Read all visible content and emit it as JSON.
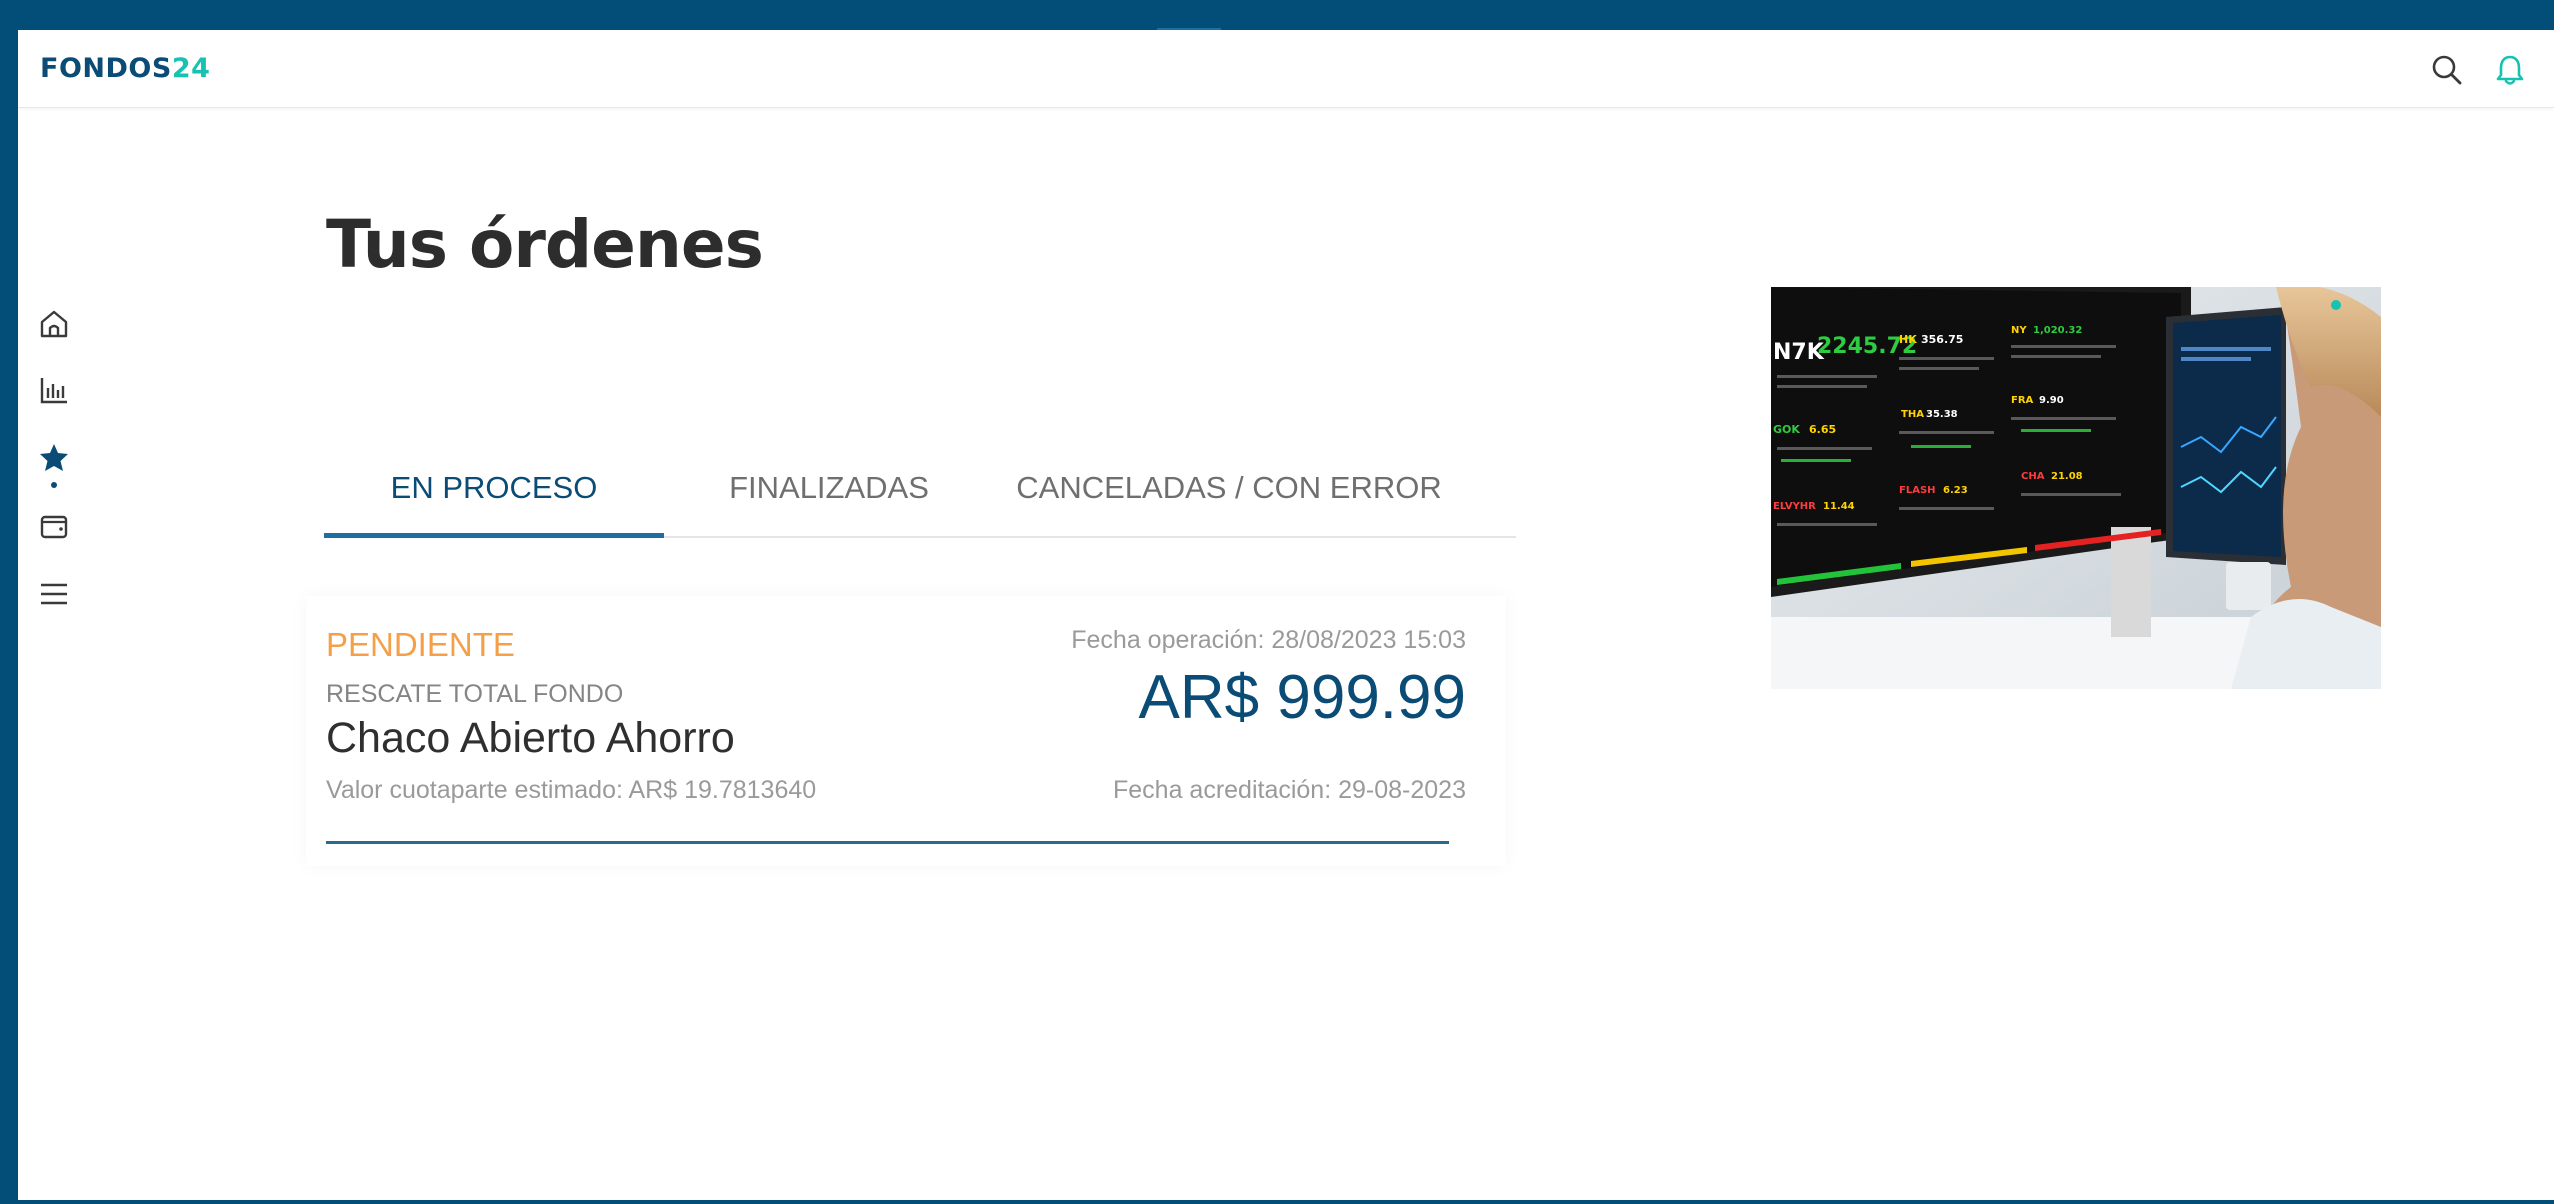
{
  "header": {
    "logo_primary": "FONDOS",
    "logo_accent": "24",
    "icons": [
      "search-icon",
      "bell-icon"
    ]
  },
  "sidebar": {
    "items": [
      {
        "icon": "home-icon"
      },
      {
        "icon": "bar-chart-icon"
      },
      {
        "icon": "star-icon",
        "active": true
      },
      {
        "icon": "wallet-icon"
      },
      {
        "icon": "menu-icon"
      }
    ]
  },
  "page": {
    "title": "Tus órdenes"
  },
  "tabs": [
    {
      "label": "EN PROCESO",
      "active": true
    },
    {
      "label": "FINALIZADAS",
      "active": false
    },
    {
      "label": "CANCELADAS / CON ERROR",
      "active": false
    }
  ],
  "order": {
    "status": "PENDIENTE",
    "operation_type": "RESCATE TOTAL FONDO",
    "fund_name": "Chaco Abierto Ahorro",
    "unit_value": "Valor cuotaparte estimado: AR$ 19.7813640",
    "operation_date": "Fecha operación: 28/08/2023 15:03",
    "amount": "AR$ 999.99",
    "credit_date": "Fecha acreditación: 29-08-2023"
  },
  "promo_screen": {
    "tickers": [
      {
        "symbol": "N7K",
        "value": "2245.72"
      },
      {
        "symbol": "HK",
        "value": "356.75"
      },
      {
        "symbol": "NY",
        "value": "1,020.32"
      },
      {
        "symbol": "GOK",
        "value": "6.65"
      },
      {
        "symbol": "THA",
        "value": "35.38"
      },
      {
        "symbol": "FRA",
        "value": "9.90"
      },
      {
        "symbol": "ELVYHR",
        "value": "11.44"
      },
      {
        "symbol": "FLASH",
        "value": "6.23"
      },
      {
        "symbol": "CHA",
        "value": "21.08"
      }
    ]
  },
  "colors": {
    "brand": "#0a4c75",
    "accent": "#17c2b0",
    "pending": "#f5a049",
    "frame": "#024e78"
  }
}
